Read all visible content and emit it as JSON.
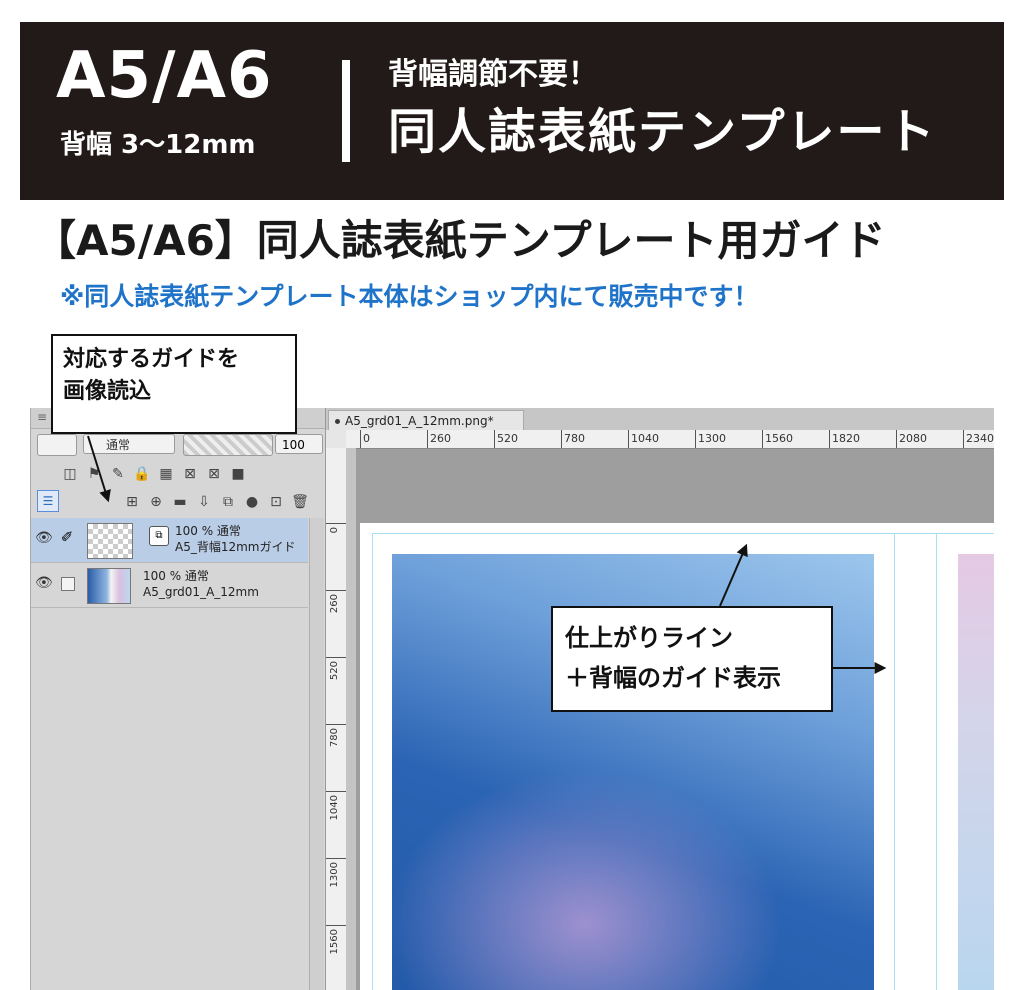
{
  "banner": {
    "size_big": "A5/A6",
    "spine_range": "背幅 3〜12mm",
    "tagline_top": "背幅調節不要！",
    "tagline_main": "同人誌表紙テンプレート"
  },
  "title": "【A5/A6】同人誌表紙テンプレート用ガイド",
  "subtitle": "※同人誌表紙テンプレート本体はショップ内にて販売中です！",
  "callouts": {
    "load_image_line1": "対応するガイドを",
    "load_image_line2": "画像読込",
    "guide_line1": "仕上がりライン",
    "guide_line2": "＋背幅のガイド表示"
  },
  "layer_panel": {
    "blend_mode": "通常",
    "opacity_value": "100",
    "layers": [
      {
        "opacity_blend": "100 % 通常",
        "name": "A5_背幅12mmガイド",
        "selected": true
      },
      {
        "opacity_blend": "100 % 通常",
        "name": "A5_grd01_A_12mm",
        "selected": false
      }
    ]
  },
  "canvas": {
    "tab_title": "A5_grd01_A_12mm.png*",
    "ruler_h": [
      "0",
      "260",
      "520",
      "780",
      "1040",
      "1300",
      "1560",
      "1820",
      "2080",
      "2340"
    ],
    "ruler_v": [
      "0",
      "260",
      "520",
      "780",
      "1040",
      "1300",
      "1560"
    ]
  },
  "colors": {
    "banner_bg": "#221a18",
    "subtitle": "#1f74c9",
    "selected_layer": "#b9cde6",
    "guide_line": "#a8dff2"
  }
}
